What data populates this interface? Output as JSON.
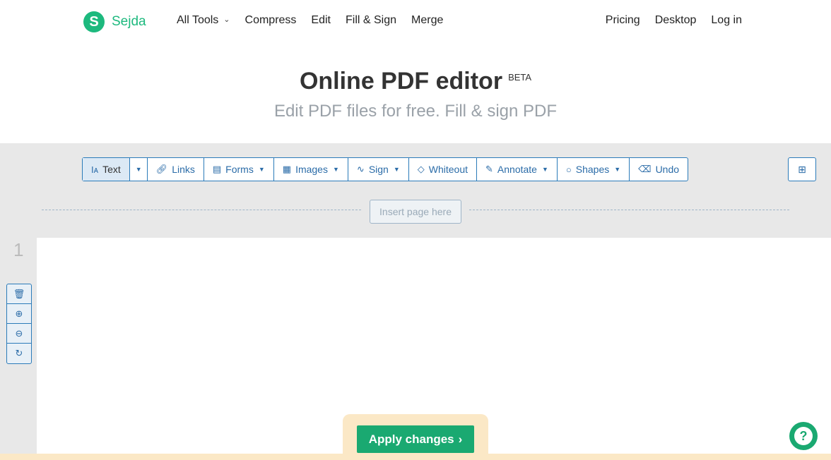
{
  "brand": {
    "logo_letter": "S",
    "name": "Sejda",
    "color": "#1db97e"
  },
  "nav": {
    "left": [
      {
        "label": "All Tools",
        "has_dropdown": true
      },
      {
        "label": "Compress"
      },
      {
        "label": "Edit"
      },
      {
        "label": "Fill & Sign"
      },
      {
        "label": "Merge"
      }
    ],
    "right": [
      {
        "label": "Pricing"
      },
      {
        "label": "Desktop"
      },
      {
        "label": "Log in"
      }
    ]
  },
  "hero": {
    "title": "Online PDF editor",
    "badge": "BETA",
    "subtitle": "Edit PDF files for free. Fill & sign PDF"
  },
  "toolbar": {
    "text": "Text",
    "links": "Links",
    "forms": "Forms",
    "images": "Images",
    "sign": "Sign",
    "whiteout": "Whiteout",
    "annotate": "Annotate",
    "shapes": "Shapes",
    "undo": "Undo"
  },
  "insert_page": "Insert page here",
  "page_number": "1",
  "apply_button": "Apply changes",
  "colors": {
    "accent": "#2b7bb9",
    "apply_green": "#1aa971",
    "apply_bg": "#fbe8c6"
  }
}
